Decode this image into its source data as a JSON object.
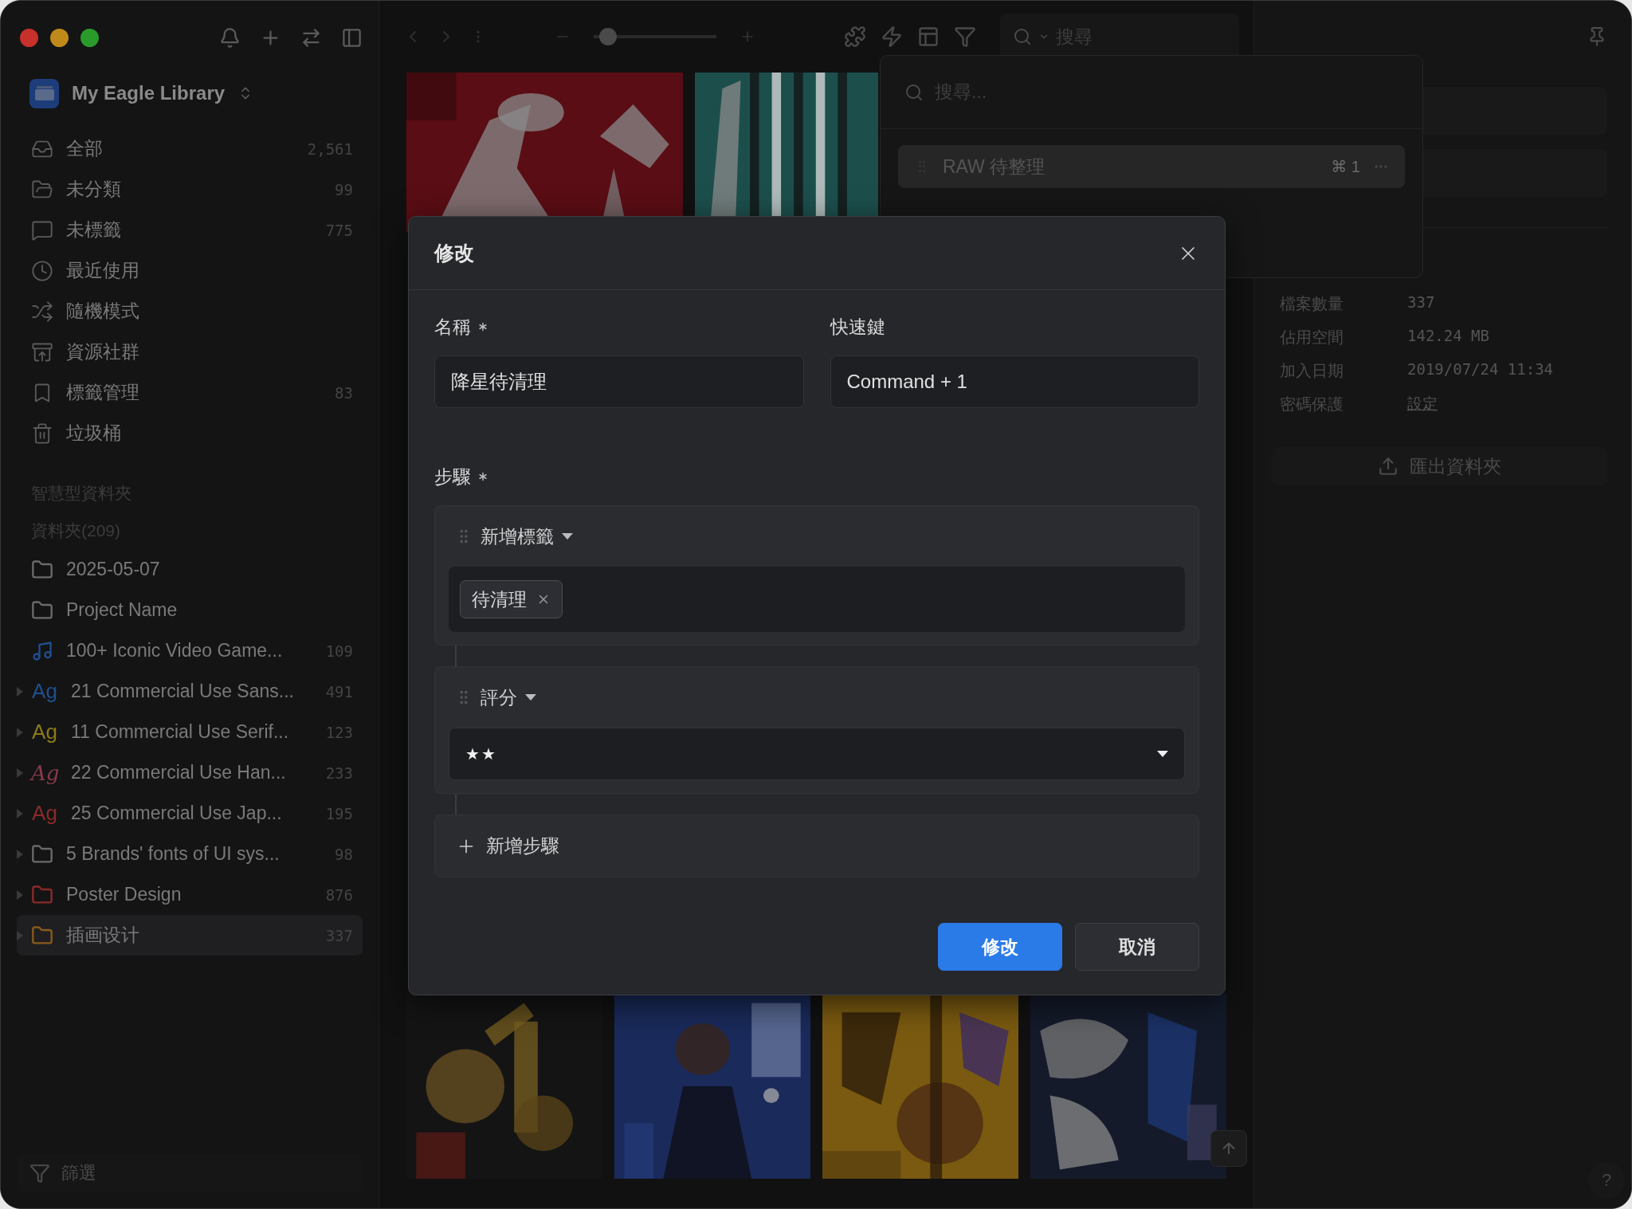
{
  "library": {
    "name": "My Eagle Library"
  },
  "nav": [
    {
      "label": "全部",
      "count": "2,561"
    },
    {
      "label": "未分類",
      "count": "99"
    },
    {
      "label": "未標籤",
      "count": "775"
    },
    {
      "label": "最近使用"
    },
    {
      "label": "隨機模式"
    },
    {
      "label": "資源社群"
    },
    {
      "label": "標籤管理",
      "count": "83"
    },
    {
      "label": "垃圾桶"
    }
  ],
  "sections": [
    "智慧型資料夾",
    "資料夾(209)"
  ],
  "folders": [
    {
      "kind": "folder",
      "label": "2025-05-07",
      "color": "#6a6a6a",
      "expandable": false,
      "selected": false
    },
    {
      "kind": "folder",
      "label": "Project Name",
      "color": "#6a6a6a",
      "expandable": false,
      "selected": false
    },
    {
      "kind": "music",
      "label": "100+ Iconic Video Game...",
      "count": "109",
      "color": "#1f4f8f",
      "expandable": false,
      "selected": false
    },
    {
      "kind": "font",
      "glyph": "Ag",
      "label": "21 Commercial Use Sans...",
      "count": "491",
      "color": "#1f4f8f",
      "expandable": true,
      "selected": false
    },
    {
      "kind": "font",
      "glyph": "Ag",
      "label": "11 Commercial Use Serif...",
      "count": "123",
      "color": "#8a7a1a",
      "expandable": true,
      "selected": false
    },
    {
      "kind": "script",
      "glyph": "Ag",
      "label": "22 Commercial Use Han...",
      "count": "233",
      "color": "#8a3a4a",
      "expandable": true,
      "selected": false
    },
    {
      "kind": "font",
      "glyph": "Ag",
      "label": "25 Commercial Use Jap...",
      "count": "195",
      "color": "#8a2a2a",
      "expandable": true,
      "selected": false
    },
    {
      "kind": "folder",
      "label": "5 Brands' fonts of UI sys...",
      "count": "98",
      "color": "#6a6a6a",
      "expandable": true,
      "selected": false
    },
    {
      "kind": "folder",
      "label": "Poster Design",
      "count": "876",
      "color": "#8a2a2a",
      "expandable": true,
      "selected": false
    },
    {
      "kind": "folder",
      "label": "插画设计",
      "count": "337",
      "color": "#8a5a1a",
      "expandable": true,
      "selected": true
    }
  ],
  "filter": {
    "placeholder": "篩選"
  },
  "toolbar": {
    "zoom": {
      "level": 0.12
    },
    "search": {
      "placeholder": "搜尋"
    }
  },
  "popup": {
    "search": {
      "placeholder": "搜尋..."
    },
    "items": [
      {
        "label": "RAW 待整理",
        "shortcut": "⌘ 1",
        "selected": true
      }
    ]
  },
  "info": {
    "rows": [
      {
        "kind": "text",
        "label": "檔案數量",
        "value": "337"
      },
      {
        "kind": "text",
        "label": "佔用空間",
        "value": "142.24 MB"
      },
      {
        "kind": "text",
        "label": "加入日期",
        "value": "2019/07/24 11:34"
      },
      {
        "kind": "link",
        "label": "密碼保護",
        "value": "設定"
      }
    ],
    "export_button": "匯出資料夾"
  },
  "help_button": "?",
  "dialog": {
    "title": "修改",
    "name_field": {
      "label": "名稱",
      "required": true,
      "value": "降星待清理"
    },
    "shortcut_field": {
      "label": "快速鍵",
      "required": false,
      "value": "Command + 1"
    },
    "steps_label": "步驟",
    "steps_required": true,
    "steps": [
      {
        "kind": "tags",
        "action": "新增標籤",
        "tags": [
          "待清理"
        ]
      },
      {
        "kind": "rating",
        "action": "評分",
        "value": "★★"
      }
    ],
    "add_step": "新增步驟",
    "buttons": [
      {
        "label": "修改",
        "primary": true
      },
      {
        "label": "取消",
        "primary": false
      }
    ]
  }
}
